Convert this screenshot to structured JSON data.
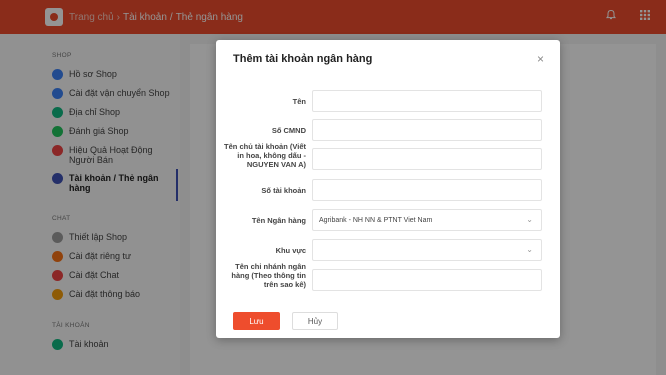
{
  "header": {
    "crumb_home": "Trang chủ",
    "crumb_sep1": "›",
    "crumb_section": "Tài khoản",
    "crumb_sep2": "/",
    "crumb_page": "Thẻ ngân hàng",
    "icons": [
      "bell-icon",
      "grid-icon"
    ]
  },
  "sidebar": {
    "shop_title": "SHOP",
    "shop_items": [
      {
        "label": "Hồ sơ Shop",
        "color": "#3b82f6"
      },
      {
        "label": "Cài đặt vận chuyển Shop",
        "color": "#3b82f6"
      },
      {
        "label": "Địa chỉ Shop",
        "color": "#10b981"
      },
      {
        "label": "Đánh giá Shop",
        "color": "#22c55e"
      },
      {
        "label": "Hiệu Quả Hoạt Động Người Bán",
        "color": "#ef4444"
      },
      {
        "label": "Tài khoản / Thẻ ngân hàng",
        "color": "#3f51b5"
      }
    ],
    "chat_title": "CHAT",
    "chat_items": [
      {
        "label": "Thiết lập Shop",
        "color": "#9e9e9e"
      },
      {
        "label": "Cài đặt riêng tư",
        "color": "#f97316"
      },
      {
        "label": "Cài đặt Chat",
        "color": "#ef4444"
      },
      {
        "label": "Cài đặt thông báo",
        "color": "#f59e0b"
      }
    ],
    "account_title": "TÀI KHOẢN",
    "account_items": [
      {
        "label": "Tài khoản",
        "color": "#10b981"
      }
    ]
  },
  "modal": {
    "title": "Thêm tài khoản ngân hàng",
    "close_label": "×",
    "fields": {
      "name_label": "Tên",
      "name_value": "",
      "id_label": "Số CMND",
      "id_value": "",
      "holder_label": "Tên chủ tài khoản (Viết in hoa, không dấu - NGUYEN VAN A)",
      "holder_value": "",
      "account_label": "Số tài khoản",
      "account_value": "",
      "bank_label": "Tên Ngân hàng",
      "bank_value": "Agribank - NH NN & PTNT Viet Nam",
      "region_label": "Khu vực",
      "region_value": "",
      "branch_label": "Tên chi nhánh ngân hàng (Theo thông tin trên sao kê)",
      "branch_value": ""
    },
    "save_label": "Lưu",
    "cancel_label": "Hủy"
  }
}
